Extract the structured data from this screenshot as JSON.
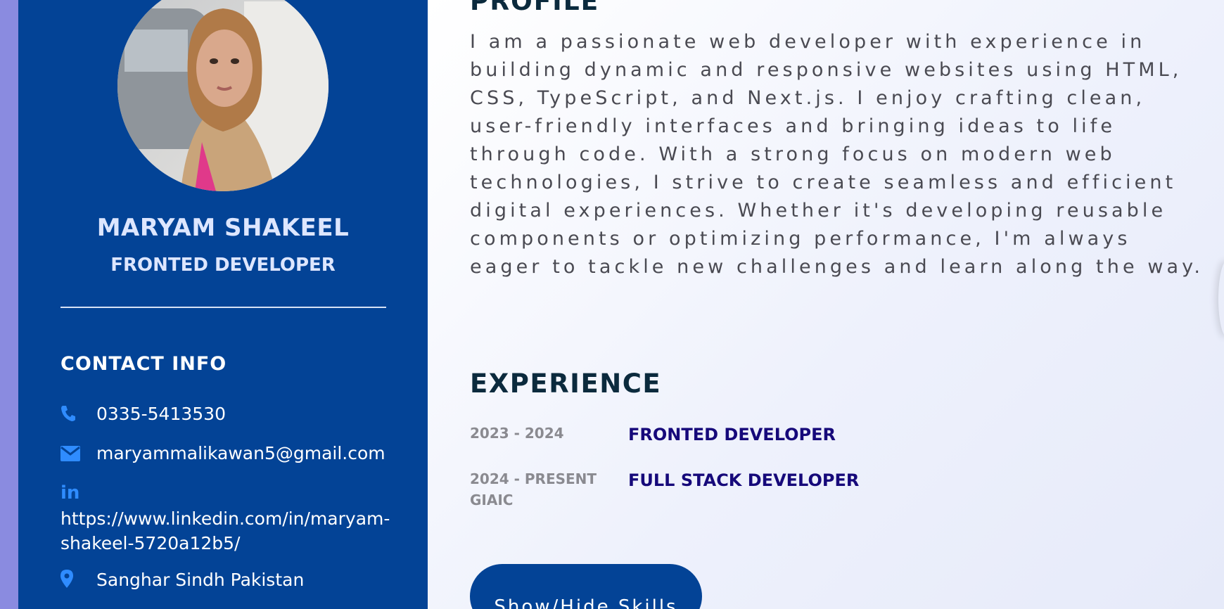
{
  "sidebar": {
    "name": "MARYAM SHAKEEL",
    "role": "FRONTED DEVELOPER",
    "contact_title": "CONTACT INFO",
    "contacts": [
      {
        "icon": "phone-icon",
        "text": "0335-5413530"
      },
      {
        "icon": "envelope-icon",
        "text": "maryammalikawan5@gmail.com"
      },
      {
        "icon": "linkedin-icon",
        "text": "https://www.linkedin.com/in/maryam-shakeel-5720a12b5/"
      },
      {
        "icon": "map-marker-icon",
        "text": "Sanghar Sindh Pakistan"
      }
    ]
  },
  "main": {
    "profile_title": "PROFILE",
    "profile_text": "I am a passionate web developer with experience in building dynamic and responsive websites using HTML, CSS, TypeScript, and Next.js. I enjoy crafting clean, user-friendly interfaces and bringing ideas to life through code. With a strong focus on modern web technologies, I strive to create seamless and efficient digital experiences. Whether it's developing reusable components or optimizing performance, I'm always eager to tackle new challenges and learn along the way.",
    "experience_title": "EXPERIENCE",
    "experience": [
      {
        "period": "2023 - 2024",
        "role": "FRONTED DEVELOPER"
      },
      {
        "period": "2024 - PRESENT GIAIC",
        "role": "FULL STACK DEVELOPER"
      }
    ],
    "skills_button": "Show/Hide Skills"
  },
  "colors": {
    "sidebar_bg": "#034396",
    "accent_icon": "#2f8cff",
    "heading": "#0b2a3d",
    "role_text": "#16097a",
    "edge": "#8a8be0"
  }
}
